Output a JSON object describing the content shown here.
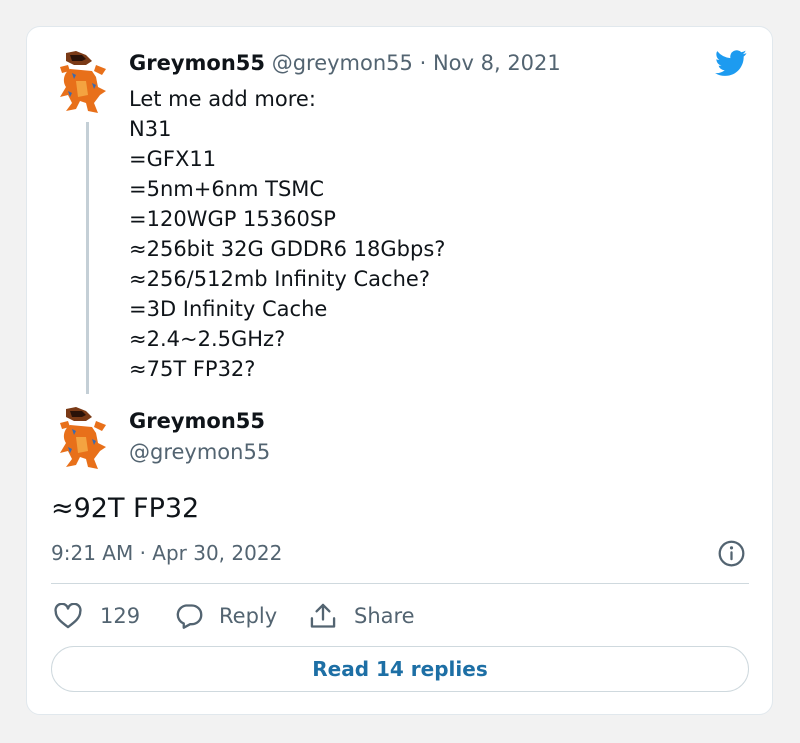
{
  "colors": {
    "twitter_blue": "#1d9bf0",
    "link_blue": "#1d6fa5",
    "text_primary": "#0f1419",
    "text_secondary": "#536471",
    "border": "#cfd9de"
  },
  "icons": {
    "logo": "twitter-bird-icon",
    "info": "info-circle-icon",
    "like": "heart-icon",
    "reply": "speech-bubble-icon",
    "share": "share-upload-icon"
  },
  "quoted_tweet": {
    "name": "Greymon55",
    "handle": "@greymon55",
    "separator": "·",
    "date": "Nov 8, 2021",
    "lines": [
      "Let me add more:",
      "N31",
      "=GFX11",
      "=5nm+6nm TSMC",
      "=120WGP 15360SP",
      "≈256bit 32G GDDR6 18Gbps?",
      "≈256/512mb Infinity Cache?",
      "=3D Infinity Cache",
      "≈2.4~2.5GHz?",
      "≈75T FP32?"
    ]
  },
  "tweet": {
    "name": "Greymon55",
    "handle": "@greymon55",
    "text": "≈92T FP32",
    "timestamp": "9:21 AM · Apr 30, 2022"
  },
  "actions": {
    "like_count": "129",
    "reply_label": "Reply",
    "share_label": "Share"
  },
  "read_replies_label": "Read 14 replies"
}
